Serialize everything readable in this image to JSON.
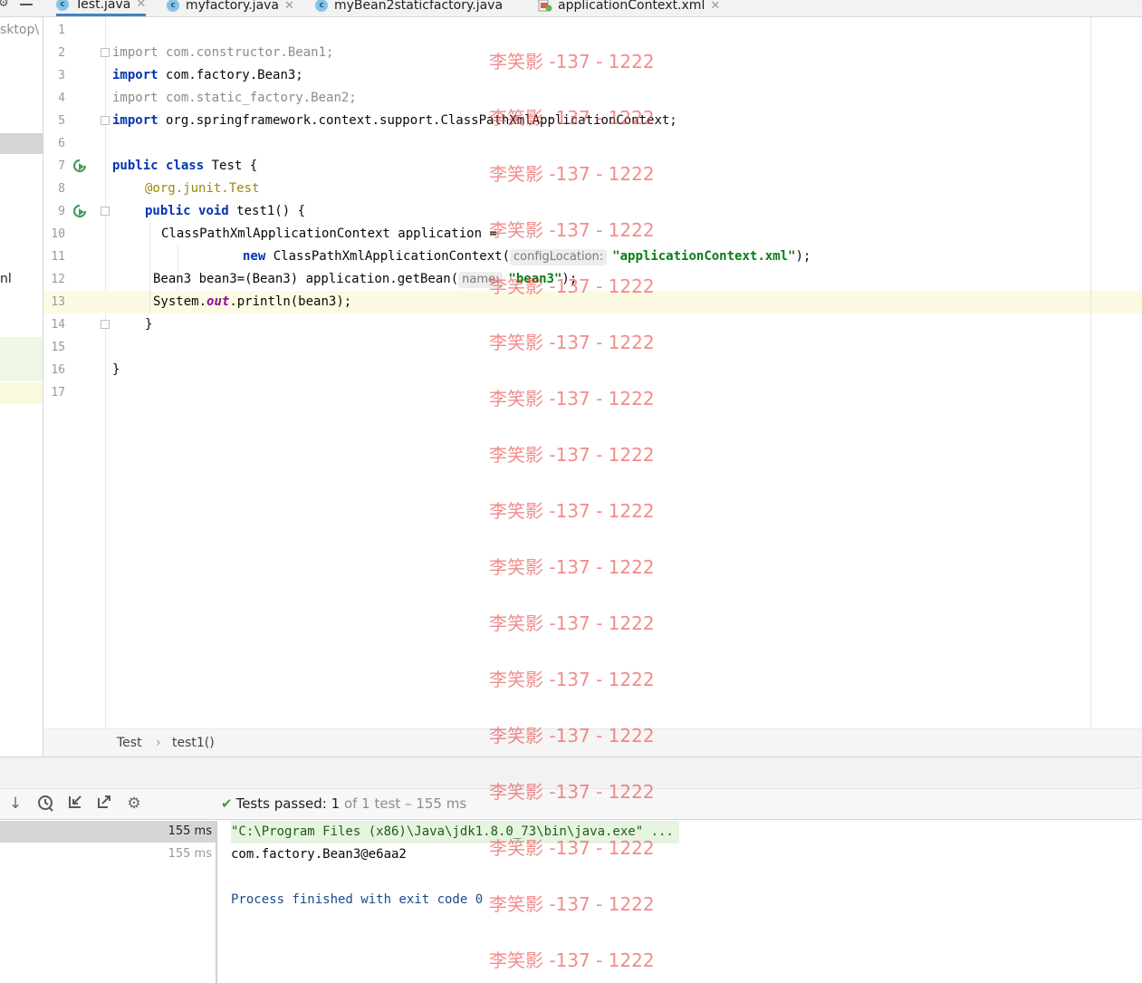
{
  "tabs": [
    {
      "label": "Test.java",
      "icon": "class-icon",
      "active": true
    },
    {
      "label": "myfactory.java",
      "icon": "class-icon",
      "active": false
    },
    {
      "label": "myBean2staticfactory.java",
      "icon": "class-icon",
      "active": false
    },
    {
      "label": "applicationContext.xml",
      "icon": "xml-file-icon",
      "active": false
    }
  ],
  "project_panel": {
    "path_fragment": "sktop\\",
    "file_fragment": "nl"
  },
  "gutter": {
    "line_numbers": [
      "1",
      "2",
      "3",
      "4",
      "5",
      "6",
      "7",
      "8",
      "9",
      "10",
      "11",
      "12",
      "13",
      "14",
      "15",
      "16",
      "17"
    ],
    "current_line": "13"
  },
  "code": {
    "l2_kw": "import",
    "l2_rest": " com.constructor.Bean1;",
    "l3_kw": "import",
    "l3_rest": " com.factory.Bean3;",
    "l4_kw": "import",
    "l4_rest": " com.static_factory.Bean2;",
    "l5_kw": "import",
    "l5_rest": " org.springframework.context.support.ClassPathXmlApplicationContext;",
    "l7_kw1": "public",
    "l7_kw2": "class",
    "l7_rest": " Test {",
    "l8_at": "@org.junit.",
    "l8_cls": "Test",
    "l9_kw1": "public",
    "l9_kw2": "void",
    "l9_rest": " test1() {",
    "l10": "ClassPathXmlApplicationContext application =",
    "l11_kw": "new",
    "l11_mid": " ClassPathXmlApplicationContext(",
    "l11_hint": "configLocation:",
    "l11_str": "\"applicationContext.xml\"",
    "l11_end": ");",
    "l12_pre": "Bean3 bean3=(Bean3) application.getBean(",
    "l12_hint": "name:",
    "l12_str": "\"bean3\"",
    "l12_end": ");",
    "l13_pre": "System.",
    "l13_field": "out",
    "l13_end": ".println(bean3);",
    "l14": "}",
    "l16": "}"
  },
  "breadcrumb": [
    "Test",
    "test1()"
  ],
  "run_toolbar": {
    "icons": [
      "arrow-down-icon",
      "history-icon",
      "import-icon",
      "export-icon",
      "gear-icon"
    ],
    "status_prefix": "Tests passed: ",
    "status_count": "1",
    "status_suffix": " of 1 test – 155 ms"
  },
  "test_tree": [
    {
      "time": "155 ms",
      "selected": true
    },
    {
      "time": "155 ms",
      "selected": false
    }
  ],
  "console": {
    "command": "\"C:\\Program Files (x86)\\Java\\jdk1.8.0_73\\bin\\java.exe\" ...",
    "output": "com.factory.Bean3@e6aa2",
    "process": "Process finished with exit code 0"
  },
  "watermark": "李笑影 -137 - 1222",
  "colors": {
    "keyword": "#0033b3",
    "string": "#067d17",
    "annotation": "#9e880d",
    "static_field": "#871094",
    "current_line": "#fcfae2",
    "passed_check": "#3f9a4b",
    "watermark": "#e84646"
  }
}
